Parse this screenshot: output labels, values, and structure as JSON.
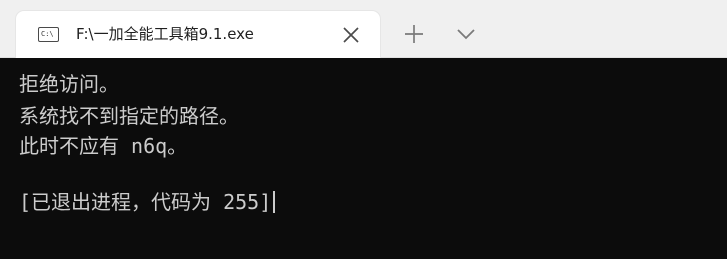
{
  "window": {
    "tab_title": "F:\\一加全能工具箱9.1.exe",
    "tab_icon_text": "C:\\",
    "icons": {
      "tab_icon": "console-icon",
      "close": "close-icon",
      "new_tab": "plus-icon",
      "dropdown": "chevron-down-icon"
    }
  },
  "terminal": {
    "lines": [
      "拒绝访问。",
      "系统找不到指定的路径。",
      "此时不应有 n6q。",
      "",
      "[已退出进程，代码为 255]"
    ]
  },
  "colors": {
    "terminal_background": "#0c0c0c",
    "terminal_text": "#cccccc",
    "titlebar_background": "#f0f0f0",
    "tab_background": "#ffffff"
  }
}
